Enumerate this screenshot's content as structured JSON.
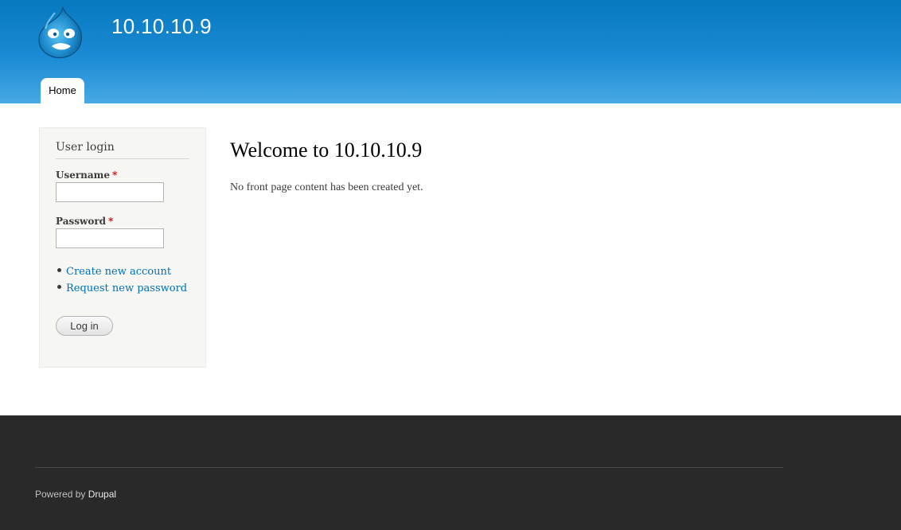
{
  "site": {
    "name": "10.10.10.9",
    "logo_icon": "drupal-drop-icon"
  },
  "nav": {
    "tabs": [
      {
        "label": "Home"
      }
    ]
  },
  "sidebar": {
    "block_title": "User login",
    "username_label": "Username",
    "password_label": "Password",
    "required_marker": "*",
    "username_value": "",
    "password_value": "",
    "links": [
      {
        "label": "Create new account"
      },
      {
        "label": "Request new password"
      }
    ],
    "login_button": "Log in"
  },
  "main": {
    "title": "Welcome to 10.10.10.9",
    "body": "No front page content has been created yet."
  },
  "footer": {
    "powered_prefix": "Powered by",
    "powered_link": "Drupal"
  },
  "colors": {
    "header_top": "#0779bf",
    "header_bottom": "#48a9e4",
    "link": "#0071b3",
    "footer_bg": "#292929",
    "required": "#cc0000"
  }
}
